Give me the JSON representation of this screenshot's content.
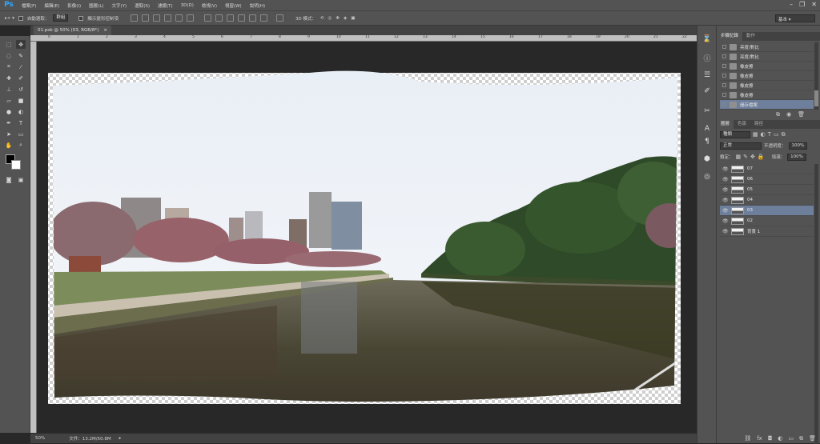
{
  "menubar": {
    "logo": "Ps",
    "items": [
      "檔案(F)",
      "編輯(E)",
      "影像(I)",
      "圖層(L)",
      "文字(Y)",
      "選取(S)",
      "濾鏡(T)",
      "3D(D)",
      "檢視(V)",
      "視窗(W)",
      "說明(H)"
    ]
  },
  "options": {
    "auto_select_label": "自動選取：",
    "auto_select_value": "群組",
    "transform_label": "顯示變形控制項",
    "mode_3d_label": "3D 模式："
  },
  "workspace": "基本",
  "document": {
    "tab_title": "01.psb @ 50% (03, RGB/8*)",
    "close": "×",
    "ruler_marks": [
      "0",
      "1",
      "2",
      "3",
      "4",
      "5",
      "6",
      "7",
      "8",
      "9",
      "10",
      "11",
      "12",
      "13",
      "14",
      "15",
      "16",
      "17",
      "18",
      "19",
      "20",
      "21",
      "22"
    ]
  },
  "status": {
    "zoom": "50%",
    "doc_info": "文件：13.2M/50.8M"
  },
  "history_panel": {
    "tabs": [
      "步驟記錄",
      "動作"
    ],
    "items": [
      {
        "label": "亮度/對比",
        "selected": false
      },
      {
        "label": "亮度/對比",
        "selected": false
      },
      {
        "label": "橡皮擦",
        "selected": false
      },
      {
        "label": "橡皮擦",
        "selected": false
      },
      {
        "label": "橡皮擦",
        "selected": false
      },
      {
        "label": "橡皮擦",
        "selected": false
      },
      {
        "label": "儲存檔案",
        "selected": true
      }
    ]
  },
  "layers_panel": {
    "tabs": [
      "圖層",
      "色版",
      "路徑"
    ],
    "kind_filter": "種類",
    "blend_mode": "正常",
    "opacity_label": "不透明度：",
    "opacity_value": "100%",
    "lock_label": "鎖定：",
    "fill_label": "填滿：",
    "fill_value": "100%",
    "layers": [
      {
        "name": "07",
        "selected": false
      },
      {
        "name": "06",
        "selected": false
      },
      {
        "name": "05",
        "selected": false
      },
      {
        "name": "04",
        "selected": false
      },
      {
        "name": "03",
        "selected": true
      },
      {
        "name": "02",
        "selected": false
      },
      {
        "name": "背景 1",
        "selected": false
      }
    ]
  },
  "colors": {
    "selection": "#6e7f9c",
    "panel_bg": "#535353",
    "workspace_bg": "#282828",
    "ps_blue": "#31a8ff"
  }
}
